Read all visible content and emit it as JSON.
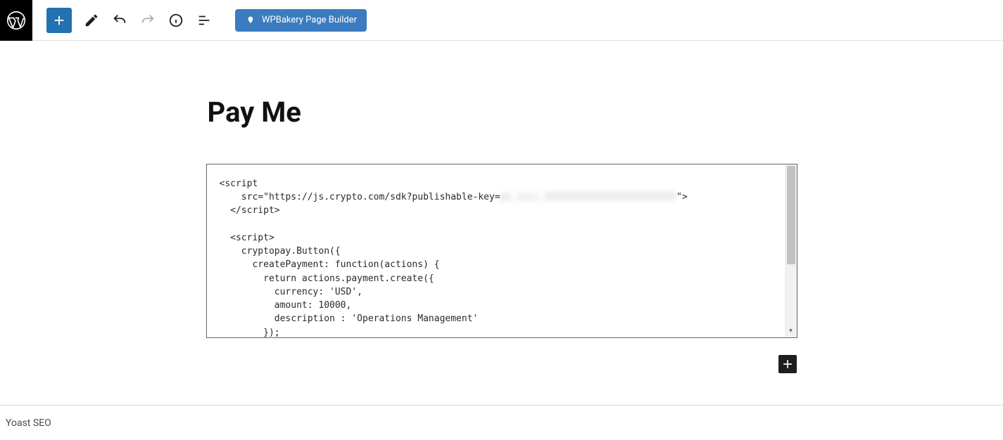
{
  "toolbar": {
    "wpbakery_label": "WPBakery Page Builder"
  },
  "page": {
    "title": "Pay Me"
  },
  "code_block": {
    "line1": "<script",
    "line2_a": "    src=\"https://js.crypto.com/sdk?publishable-key=",
    "line2_blur": "pk_test_XXXXXXXXXXXXXXXXXXXXXXXX",
    "line2_b": "\">",
    "line3": "  </script>",
    "line4": "",
    "line5": "  <script>",
    "line6": "    cryptopay.Button({",
    "line7": "      createPayment: function(actions) {",
    "line8": "        return actions.payment.create({",
    "line9": "          currency: 'USD',",
    "line10": "          amount: 10000,",
    "line11": "          description : 'Operations Management'",
    "line12": "        });"
  },
  "footer": {
    "label": "Yoast SEO"
  }
}
